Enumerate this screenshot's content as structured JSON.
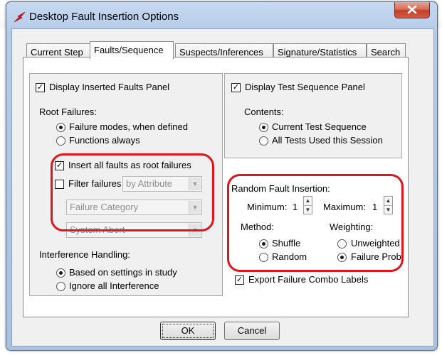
{
  "window": {
    "title": "Desktop Fault Insertion Options"
  },
  "tabs": [
    "Current Step",
    "Faults/Sequence",
    "Suspects/Inferences",
    "Signature/Statistics",
    "Search"
  ],
  "left": {
    "display_inserted_faults": "Display Inserted Faults Panel",
    "root_failures_label": "Root Failures:",
    "root_options": [
      "Failure modes, when defined",
      "Functions always"
    ],
    "insert_all_roots": "Insert all faults as root failures",
    "filter_failures": "Filter failures",
    "filter_by_value": "by Attribute",
    "category_value": "Failure Category",
    "system_value": "System Abort",
    "interference_label": "Interference Handling:",
    "interference_options": [
      "Based on settings in study",
      "Ignore all Interference"
    ]
  },
  "right": {
    "display_test_sequence": "Display Test Sequence Panel",
    "contents_label": "Contents:",
    "contents_options": [
      "Current Test Sequence",
      "All Tests Used this Session"
    ],
    "random_label": "Random Fault Insertion:",
    "minimum_label": "Minimum:",
    "minimum_value": "1",
    "maximum_label": "Maximum:",
    "maximum_value": "1",
    "method_label": "Method:",
    "method_options": [
      "Shuffle",
      "Random"
    ],
    "weighting_label": "Weighting:",
    "weighting_options": [
      "Unweighted",
      "Failure Prob."
    ],
    "export_label": "Export Failure Combo Labels"
  },
  "buttons": {
    "ok": "OK",
    "cancel": "Cancel"
  },
  "check_mark": "✓",
  "colors": {
    "highlight": "#e0141c",
    "window_frame": "#b4cbe8",
    "close_button": "#c2402b"
  }
}
